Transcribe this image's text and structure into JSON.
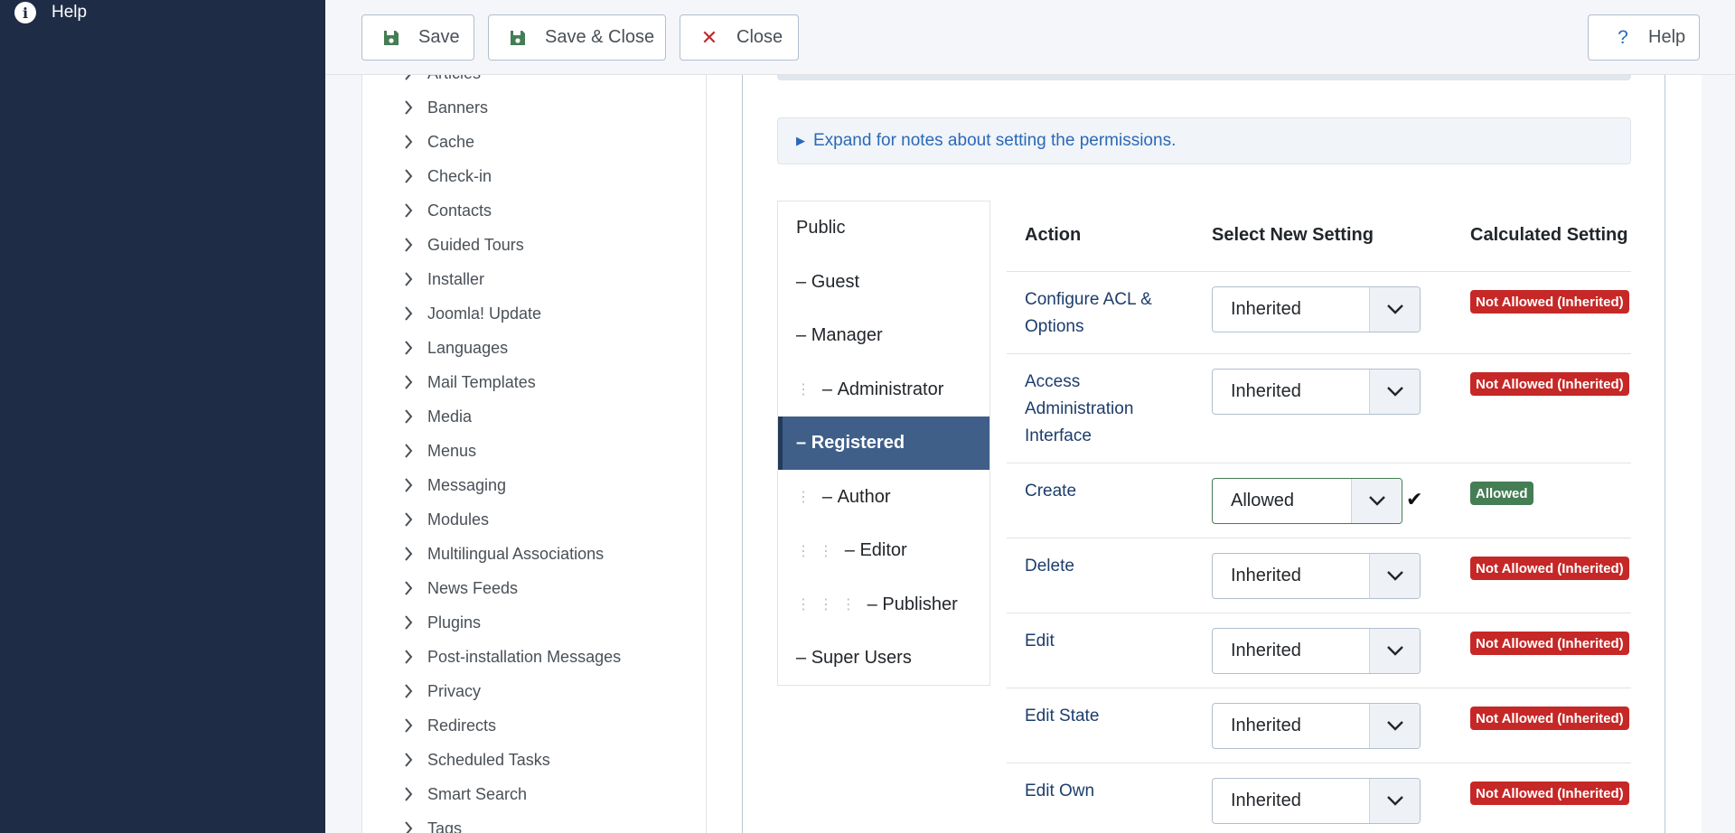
{
  "sidebar": {
    "help_label": "Help"
  },
  "toolbar": {
    "save_label": "Save",
    "save_close_label": "Save & Close",
    "close_label": "Close",
    "help_label": "Help"
  },
  "components": [
    "Articles",
    "Banners",
    "Cache",
    "Check-in",
    "Contacts",
    "Guided Tours",
    "Installer",
    "Joomla! Update",
    "Languages",
    "Mail Templates",
    "Media",
    "Menus",
    "Messaging",
    "Modules",
    "Multilingual Associations",
    "News Feeds",
    "Plugins",
    "Post-installation Messages",
    "Privacy",
    "Redirects",
    "Scheduled Tasks",
    "Smart Search",
    "Tags"
  ],
  "permissions": {
    "expand_notes": "Expand for notes about setting the permissions.",
    "groups": [
      {
        "name": "Public",
        "prefix": "",
        "depth": 0,
        "active": false
      },
      {
        "name": "Guest",
        "prefix": "– ",
        "depth": 0,
        "active": false
      },
      {
        "name": "Manager",
        "prefix": "– ",
        "depth": 0,
        "active": false
      },
      {
        "name": "Administrator",
        "prefix": "– ",
        "depth": 1,
        "active": false
      },
      {
        "name": "Registered",
        "prefix": "– ",
        "depth": 0,
        "active": true
      },
      {
        "name": "Author",
        "prefix": "– ",
        "depth": 1,
        "active": false
      },
      {
        "name": "Editor",
        "prefix": "– ",
        "depth": 2,
        "active": false
      },
      {
        "name": "Publisher",
        "prefix": "– ",
        "depth": 3,
        "active": false
      },
      {
        "name": "Super Users",
        "prefix": "– ",
        "depth": 0,
        "active": false
      }
    ],
    "headers": {
      "action": "Action",
      "select": "Select New Setting",
      "calculated": "Calculated Setting"
    },
    "rows": [
      {
        "action": "Configure ACL & Options",
        "setting": "Inherited",
        "calculated": "Not Allowed (Inherited)",
        "allowed": false
      },
      {
        "action": "Access Administration Interface",
        "setting": "Inherited",
        "calculated": "Not Allowed (Inherited)",
        "allowed": false
      },
      {
        "action": "Create",
        "setting": "Allowed",
        "calculated": "Allowed",
        "allowed": true
      },
      {
        "action": "Delete",
        "setting": "Inherited",
        "calculated": "Not Allowed (Inherited)",
        "allowed": false
      },
      {
        "action": "Edit",
        "setting": "Inherited",
        "calculated": "Not Allowed (Inherited)",
        "allowed": false
      },
      {
        "action": "Edit State",
        "setting": "Inherited",
        "calculated": "Not Allowed (Inherited)",
        "allowed": false
      },
      {
        "action": "Edit Own",
        "setting": "Inherited",
        "calculated": "Not Allowed (Inherited)",
        "allowed": false
      }
    ]
  },
  "colors": {
    "sidebar": "#1e2c46",
    "active_group": "#3f5f89",
    "link": "#2a69b8",
    "danger": "#c52827",
    "success": "#457d54"
  },
  "icons": {
    "save": "floppy-disk-icon",
    "close": "x-icon",
    "help": "question-icon",
    "info": "info-circle-icon",
    "chevron": "chevron-right-icon",
    "dropdown": "chevron-down-icon",
    "check": "checkmark-icon"
  }
}
